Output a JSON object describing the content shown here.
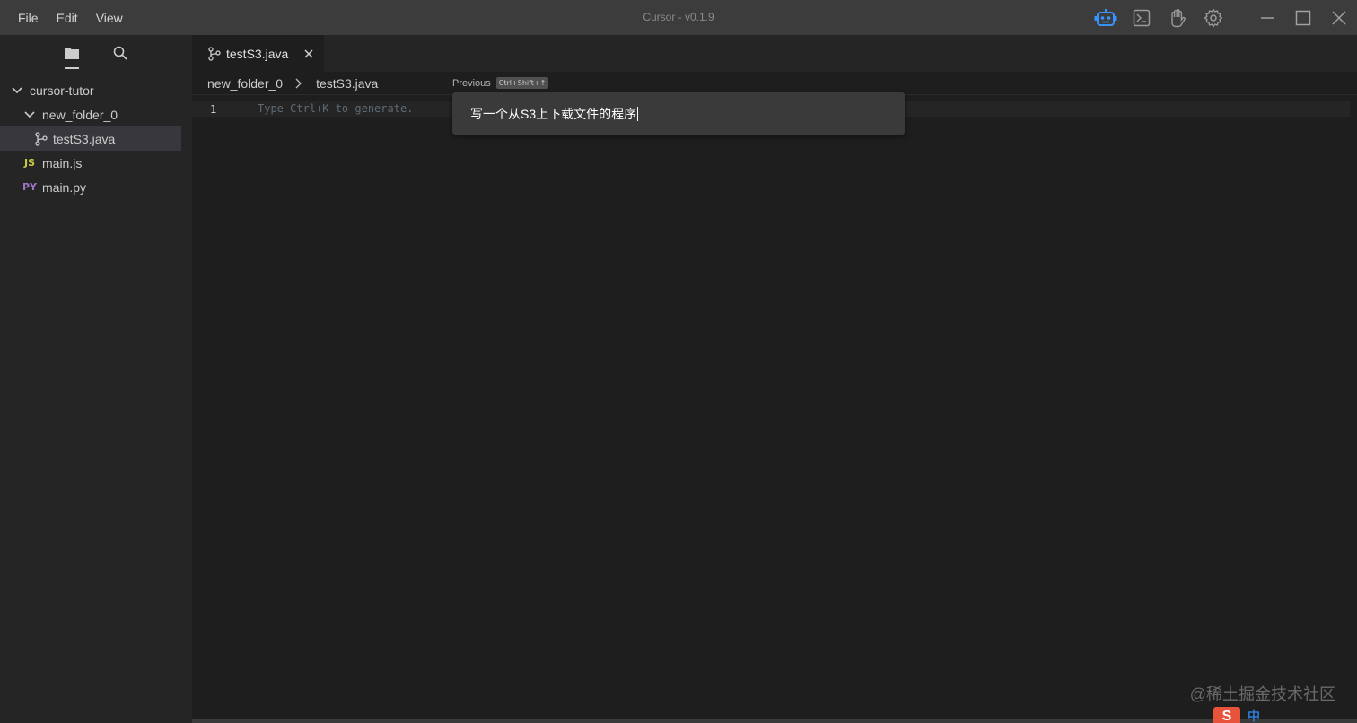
{
  "menu": {
    "file": "File",
    "edit": "Edit",
    "view": "View"
  },
  "window": {
    "title": "Cursor - v0.1.9"
  },
  "title_actions": {
    "icons": [
      "robot-icon",
      "terminal-icon",
      "hand-icon",
      "gear-icon"
    ]
  },
  "sidebar": {
    "icons": [
      "folder-icon",
      "search-icon"
    ],
    "tree": {
      "root": "cursor-tutor",
      "folder": "new_folder_0",
      "selected_file": "testS3.java",
      "files": [
        {
          "badge": "JS",
          "name": "main.js"
        },
        {
          "badge": "PY",
          "name": "main.py"
        }
      ]
    }
  },
  "editor": {
    "tab": {
      "label": "testS3.java"
    },
    "breadcrumbs": {
      "folder": "new_folder_0",
      "file": "testS3.java"
    },
    "line_number": "1",
    "placeholder": "Type Ctrl+K to generate.",
    "previous_label": "Previous",
    "previous_shortcut": "Ctrl+Shift+↑",
    "prompt_text": "写一个从S3上下载文件的程序"
  },
  "watermark": "@稀土掘金技术社区",
  "ime": {
    "logo": "S",
    "mode": "中"
  },
  "colors": {
    "accent": "#3794ff",
    "badge_js": "#cbcb41",
    "badge_py": "#a074c4"
  }
}
